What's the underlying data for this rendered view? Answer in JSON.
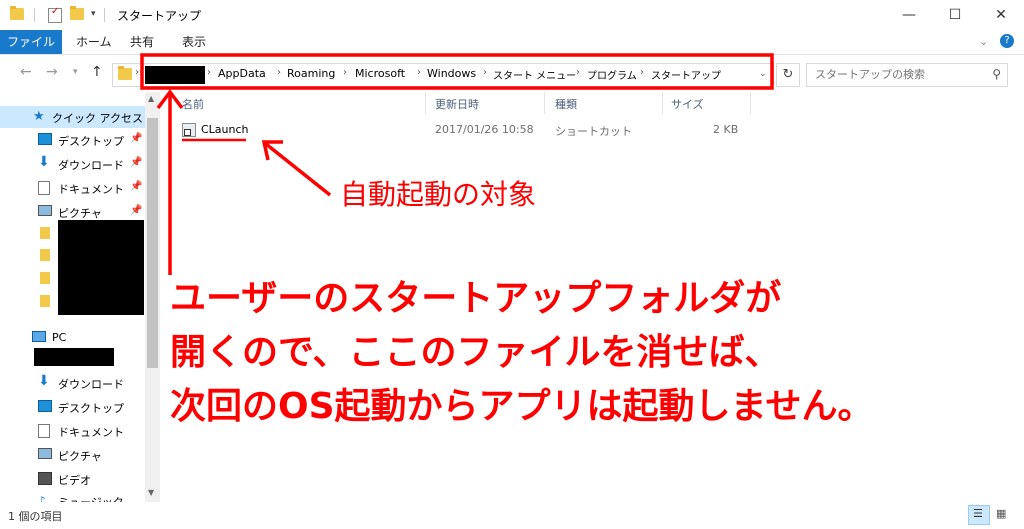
{
  "window": {
    "title": "スタートアップ",
    "minimize": "—",
    "maximize": "☐",
    "close": "✕",
    "help": "?"
  },
  "ribbon": {
    "tabs": [
      "ファイル",
      "ホーム",
      "共有",
      "表示"
    ]
  },
  "address": {
    "crumbs": [
      "AppData",
      "Roaming",
      "Microsoft",
      "Windows",
      "スタート メニュー",
      "プログラム",
      "スタートアップ"
    ],
    "search_placeholder": "スタートアップの検索"
  },
  "nav": {
    "quick_access": "クイック アクセス",
    "qa_items": [
      "デスクトップ",
      "ダウンロード",
      "ドキュメント",
      "ピクチャ"
    ],
    "pc": "PC",
    "pc_items": [
      "ダウンロード",
      "デスクトップ",
      "ドキュメント",
      "ピクチャ",
      "ビデオ",
      "ミュージック"
    ]
  },
  "columns": {
    "name": "名前",
    "date": "更新日時",
    "type": "種類",
    "size": "サイズ"
  },
  "files": [
    {
      "name": "CLaunch",
      "date": "2017/01/26 10:58",
      "type": "ショートカット",
      "size": "2 KB"
    }
  ],
  "status": {
    "count": "1 個の項目"
  },
  "annotations": {
    "target": "自動起動の対象",
    "line1": "ユーザーのスタートアップフォルダが",
    "line2": "開くので、ここのファイルを消せば、",
    "line3": "次回のOS起動からアプリは起動しません。"
  },
  "colors": {
    "accent": "#1979ca",
    "annotation": "#ff0000",
    "selected": "#cce8ff",
    "folder": "#f3c94c"
  }
}
